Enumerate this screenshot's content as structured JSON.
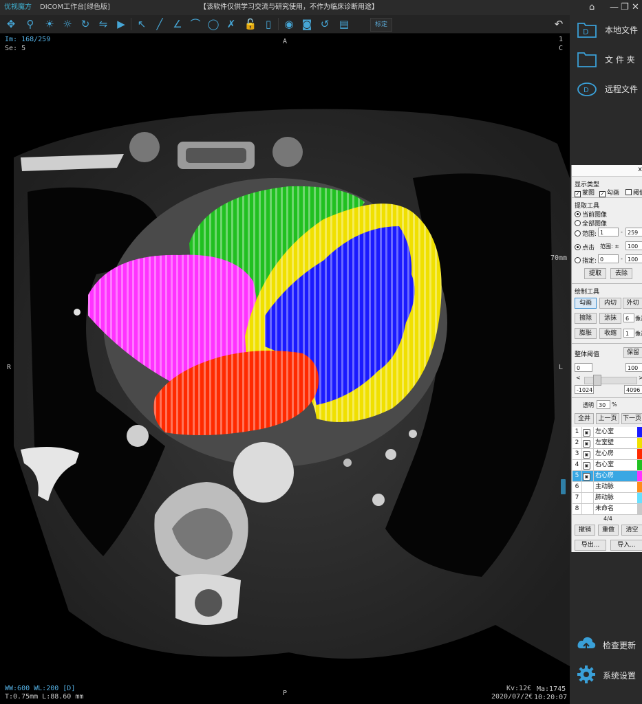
{
  "titlebar": {
    "app_name": "优视魔方",
    "workbench": "DICOM工作台[绿色版]",
    "notice": "【该软件仅供学习交流与研究使用，不作为临床诊断用途】"
  },
  "toolbar": {
    "calibrate_label": "标定",
    "tools": [
      "pan-icon",
      "zoom-icon",
      "window-level-icon",
      "auto-window-icon",
      "rotate-icon",
      "flip-icon",
      "play-icon",
      "pointer-icon",
      "line-icon",
      "angle-icon",
      "arc-icon",
      "roi-icon",
      "erase-measure-icon",
      "lock-icon",
      "delete-icon",
      "view-icon",
      "snapshot-icon",
      "reset-icon",
      "report-icon"
    ]
  },
  "viewer": {
    "image_index": "Im: 168/259",
    "series": "Se: 5",
    "orient_top": "A",
    "orient_bottom": "P",
    "orient_left": "R",
    "orient_right": "L",
    "top_right_1": "1",
    "top_right_2": "C",
    "scale_label": "70mm",
    "window": "WW:600 WL:200 [D]",
    "thickness": "T:0.75mm L:88.60 mm",
    "kv": "Kv:12€",
    "ma": "Ma:1745",
    "date": "2020/07/2€",
    "time": "10:20:07"
  },
  "nav": {
    "local_files": "本地文件",
    "folder": "文 件 夹",
    "remote_files": "远程文件",
    "check_update": "检查更新",
    "system_settings": "系统设置"
  },
  "seg_panel": {
    "close": "x",
    "display_type": "显示类型",
    "mask": "蒙图",
    "outline": "勾画",
    "threshold_short": "阈值",
    "extract_tools": "提取工具",
    "current_image": "当前图像",
    "all_images": "全部图像",
    "range": "范围:",
    "range_from": "1",
    "range_dash": "-",
    "range_to": "259",
    "click_point": "点击",
    "click_range": "范围: ±",
    "click_range_val": "100",
    "specify": "指定:",
    "specify_from": "0",
    "specify_to": "100",
    "extract_btn": "提取",
    "remove_btn": "去除",
    "draw_tools": "绘制工具",
    "outline_btn": "勾画",
    "inner_cut_btn": "内切",
    "outer_cut_btn": "外切",
    "erase_btn": "擦除",
    "paint_btn": "涂抹",
    "paint_size": "6",
    "pixel_unit": "像素",
    "expand_btn": "膨胀",
    "shrink_btn": "收缩",
    "shrink_size": "1",
    "pixel_unit2": "像素",
    "global_threshold": "整体阈值",
    "keep_btn": "保留",
    "th_min": "0",
    "th_max": "100",
    "arrow_left": "<",
    "arrow_right": ">",
    "th_low": "-1024",
    "th_high": "4096",
    "opacity_label": "透明",
    "opacity_val": "30",
    "percent": "%",
    "merge_btn": "全并",
    "prev_page_btn": "上一页",
    "next_page_btn": "下一页",
    "pager": "4/4",
    "undo_btn": "撤销",
    "redo_btn": "重做",
    "clear_btn": "清空",
    "export_btn": "导出...",
    "import_btn": "导入..."
  },
  "labels": [
    {
      "idx": "1",
      "name": "左心室",
      "color": "#1a1aff",
      "locked": true
    },
    {
      "idx": "2",
      "name": "左室壁",
      "color": "#f0e000",
      "locked": true
    },
    {
      "idx": "3",
      "name": "左心房",
      "color": "#ff2a00",
      "locked": true
    },
    {
      "idx": "4",
      "name": "右心室",
      "color": "#20c020",
      "locked": true
    },
    {
      "idx": "5",
      "name": "右心房",
      "color": "#ff33ff",
      "locked": true,
      "selected": true
    },
    {
      "idx": "6",
      "name": "主动脉",
      "color": "#ff8c1a",
      "locked": false
    },
    {
      "idx": "7",
      "name": "肺动脉",
      "color": "#66e0ff",
      "locked": false
    },
    {
      "idx": "8",
      "name": "未命名",
      "color": "#c8c8c8",
      "locked": false
    }
  ]
}
